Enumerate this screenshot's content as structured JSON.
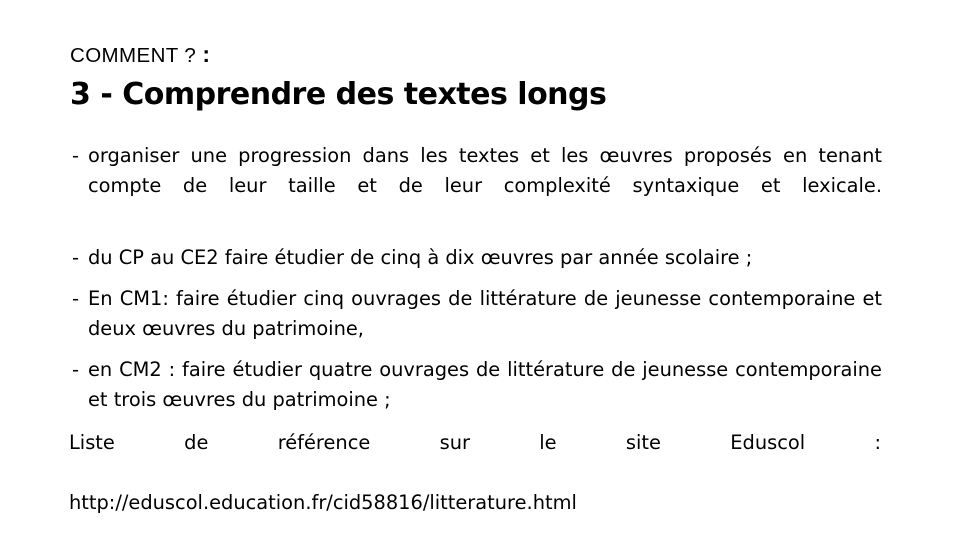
{
  "slide": {
    "background_color": "#ffffff",
    "text_color": "#000000",
    "kicker": "COMMENT ? ",
    "kicker_colon": ":",
    "title": "3 - Comprendre des textes longs"
  },
  "bullets": [
    {
      "marker": "-",
      "text": "organiser une progression dans les textes et les œuvres proposés en tenant compte de leur taille et de leur complexité syntaxique et lexicale."
    },
    {
      "marker": "-",
      "text": "du CP au CE2 faire étudier de cinq à dix œuvres par année scolaire ;"
    },
    {
      "marker": "-",
      "text": "En CM1: faire étudier cinq ouvrages de littérature de jeunesse contemporaine et deux œuvres du patrimoine,"
    },
    {
      "marker": "-",
      "text": "en CM2 : faire étudier quatre ouvrages de littérature de jeunesse contemporaine et trois œuvres du patrimoine ;"
    }
  ],
  "closing": {
    "lead": "Liste de référence sur le site Eduscol :",
    "url": "http://eduscol.education.fr/cid58816/litterature.html"
  }
}
